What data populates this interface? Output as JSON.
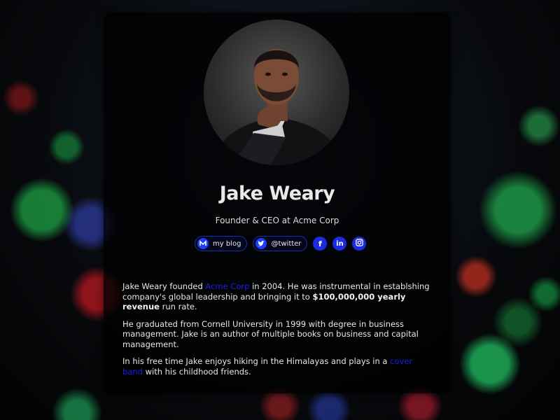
{
  "profile": {
    "name": "Jake Weary",
    "role": "Founder & CEO at Acme Corp"
  },
  "socials": {
    "blog_label": "my blog",
    "twitter_label": "@twitter",
    "facebook_glyph": "f",
    "linkedin_glyph": "in",
    "icons": [
      "medium-icon",
      "twitter-icon",
      "facebook-icon",
      "linkedin-icon",
      "instagram-icon"
    ]
  },
  "bio": {
    "p1_a": "Jake Weary founded ",
    "p1_link": "Acme Corp",
    "p1_b": " in 2004. He was instrumental in establshing company's global leadership and bringing it to ",
    "p1_bold": "$100,000,000 yearly revenue",
    "p1_c": " run rate.",
    "p2": "He graduated from Cornell University in 1999 with degree in business management. Jake is an author of multiple books on business and capital management.",
    "p3_a": "In his free time Jake enjoys hiking in the Himalayas and plays in a ",
    "p3_link": "cover band",
    "p3_b": " with his childhood friends."
  },
  "colors": {
    "accent": "#1a3cff",
    "link": "#1d1df0",
    "card_bg": "rgba(0,0,0,0.78)"
  }
}
